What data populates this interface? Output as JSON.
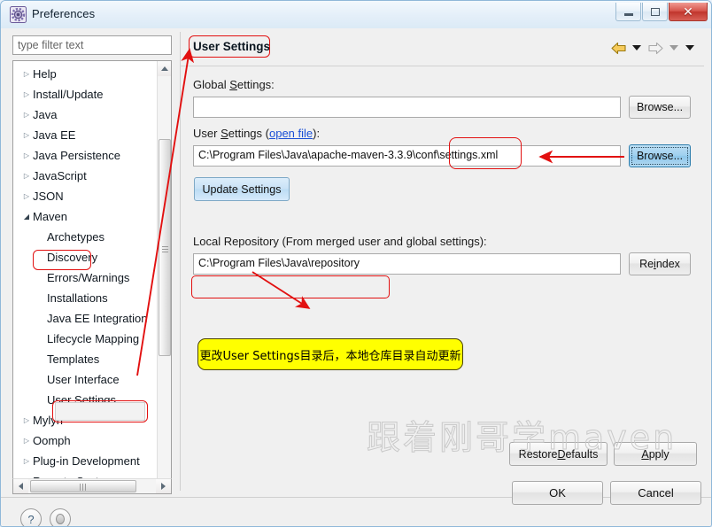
{
  "window": {
    "title": "Preferences",
    "icon": "preferences-gear-icon",
    "buttons": {
      "minimize": "minimize-icon",
      "maximize": "maximize-icon",
      "close": "close-icon"
    }
  },
  "sidebar": {
    "filter": {
      "placeholder": "type filter text",
      "value": ""
    },
    "items": [
      {
        "label": "Help",
        "indent": 0,
        "twisty": "collapsed"
      },
      {
        "label": "Install/Update",
        "indent": 0,
        "twisty": "collapsed"
      },
      {
        "label": "Java",
        "indent": 0,
        "twisty": "collapsed"
      },
      {
        "label": "Java EE",
        "indent": 0,
        "twisty": "collapsed"
      },
      {
        "label": "Java Persistence",
        "indent": 0,
        "twisty": "collapsed"
      },
      {
        "label": "JavaScript",
        "indent": 0,
        "twisty": "collapsed"
      },
      {
        "label": "JSON",
        "indent": 0,
        "twisty": "collapsed"
      },
      {
        "label": "Maven",
        "indent": 0,
        "twisty": "expanded"
      },
      {
        "label": "Archetypes",
        "indent": 1,
        "twisty": "none"
      },
      {
        "label": "Discovery",
        "indent": 1,
        "twisty": "none"
      },
      {
        "label": "Errors/Warnings",
        "indent": 1,
        "twisty": "none"
      },
      {
        "label": "Installations",
        "indent": 1,
        "twisty": "none"
      },
      {
        "label": "Java EE Integration",
        "indent": 1,
        "twisty": "none"
      },
      {
        "label": "Lifecycle Mapping",
        "indent": 1,
        "twisty": "none"
      },
      {
        "label": "Templates",
        "indent": 1,
        "twisty": "none"
      },
      {
        "label": "User Interface",
        "indent": 1,
        "twisty": "none"
      },
      {
        "label": "User Settings",
        "indent": 1,
        "twisty": "none"
      },
      {
        "label": "Mylyn",
        "indent": 0,
        "twisty": "collapsed"
      },
      {
        "label": "Oomph",
        "indent": 0,
        "twisty": "collapsed"
      },
      {
        "label": "Plug-in Development",
        "indent": 0,
        "twisty": "collapsed"
      },
      {
        "label": "Remote Systems",
        "indent": 0,
        "twisty": "collapsed"
      }
    ],
    "selected": "User Settings"
  },
  "panel": {
    "title": "User Settings",
    "nav": {
      "back": "back-arrow-icon",
      "back_menu": "chevron-down-icon",
      "forward": "forward-arrow-icon",
      "forward_menu": "chevron-down-icon",
      "more_menu": "chevron-down-icon"
    },
    "global_settings": {
      "label_pre": "Global ",
      "label_mnemonic": "S",
      "label_post": "ettings:",
      "value": "",
      "browse_label": "Browse..."
    },
    "user_settings": {
      "label_pre": "User ",
      "label_mnemonic": "S",
      "label_mid": "ettings (",
      "link": "open file",
      "label_post": "):",
      "value": "C:\\Program Files\\Java\\apache-maven-3.3.9\\conf\\settings.xml",
      "browse_label": "Browse..."
    },
    "update_settings_label": "Update Settings",
    "local_repository": {
      "label": "Local Repository (From merged user and global settings):",
      "value": "C:\\Program Files\\Java\\repository",
      "reindex_label_pre": "Re",
      "reindex_mnemonic": "i",
      "reindex_label_post": "ndex"
    },
    "restore_defaults": {
      "pre": "Restore ",
      "mnemonic": "D",
      "post": "efaults"
    },
    "apply": {
      "pre": "",
      "mnemonic": "A",
      "post": "pply"
    }
  },
  "annotations": {
    "note_text": "更改User Settings目录后，本地仓库目录自动更新",
    "note_color": "#ffff00",
    "highlight_color": "#e21010"
  },
  "watermark": {
    "text": "跟着刚哥学maven"
  },
  "footer": {
    "help_icon": "?",
    "secondary_icon": "apply-all-icon",
    "ok_label": "OK",
    "cancel_label": "Cancel"
  }
}
